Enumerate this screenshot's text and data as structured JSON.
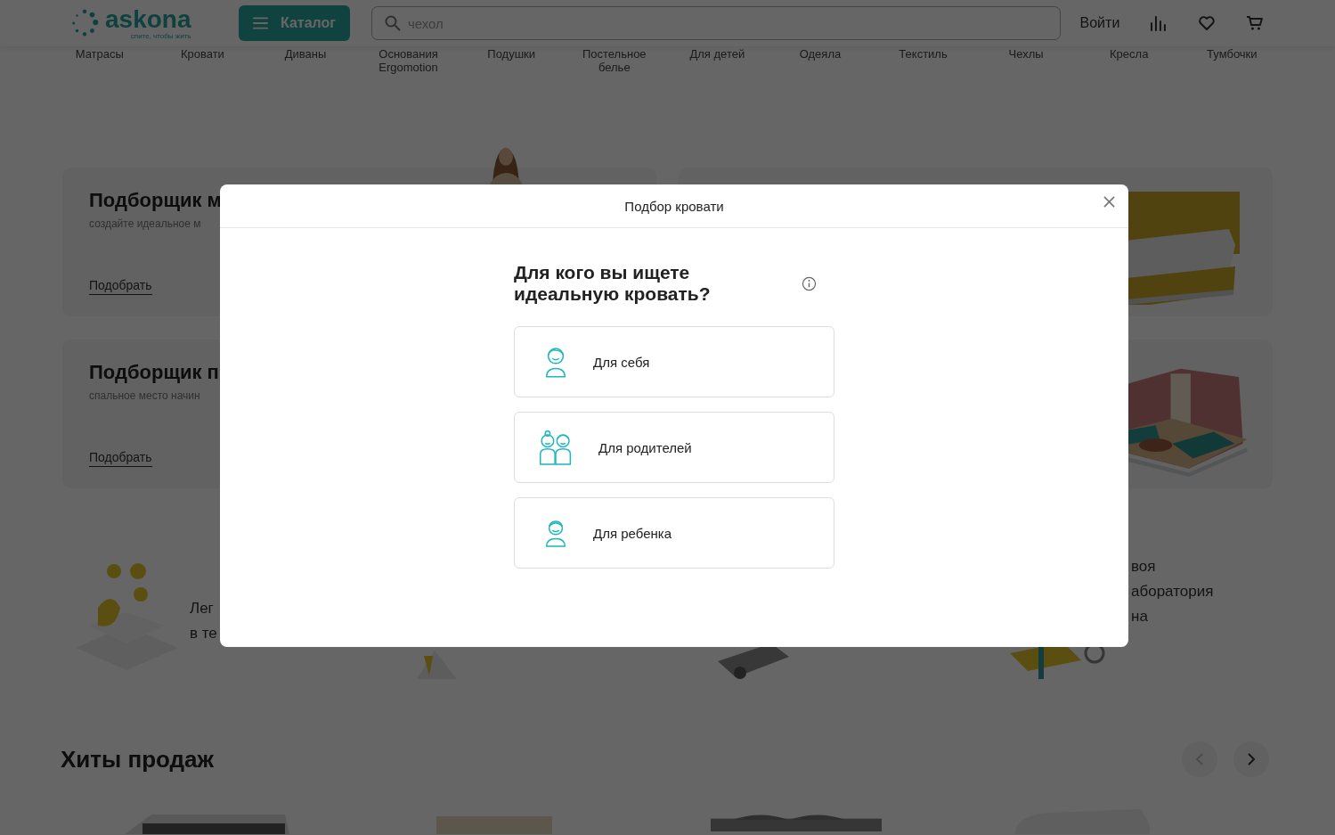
{
  "header": {
    "logo": {
      "name": "askona",
      "tagline": "спите, чтобы жить"
    },
    "catalog_button": "Каталог",
    "search": {
      "placeholder": "чехол"
    },
    "login": "Войти"
  },
  "nav": [
    "Матрасы",
    "Кровати",
    "Диваны",
    "Основания Ergomotion",
    "Подушки",
    "Постельное белье",
    "Для детей",
    "Одеяла",
    "Текстиль",
    "Чехлы",
    "Кресла",
    "Тумбочки"
  ],
  "pickers": [
    {
      "title": "Подборщик м",
      "subtitle": "создайте идеальное м",
      "link": "Подобрать",
      "kind": "bed"
    },
    {
      "title": "Подборщик п",
      "subtitle": "спальное место начин",
      "link": "Подобрать",
      "kind": "room"
    }
  ],
  "features": [
    {
      "lines": [
        "Лег",
        "в те"
      ]
    },
    {
      "lines": [
        "воя",
        "аборатория",
        "на"
      ]
    }
  ],
  "hits": {
    "title": "Хиты продаж"
  },
  "modal": {
    "title": "Подбор кровати",
    "question": "Для кого вы ищете идеальную кровать?",
    "options": [
      {
        "label": "Для себя",
        "kind": "self"
      },
      {
        "label": "Для родителей",
        "kind": "parents"
      },
      {
        "label": "Для ребенка",
        "kind": "child"
      }
    ]
  }
}
